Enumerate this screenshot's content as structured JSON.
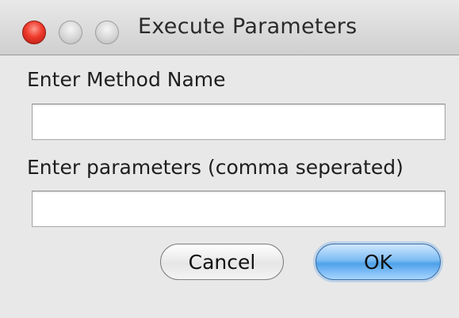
{
  "window": {
    "title": "Execute Parameters"
  },
  "form": {
    "method_label": "Enter Method Name",
    "method_value": "",
    "params_label": "Enter parameters (comma seperated)",
    "params_value": ""
  },
  "buttons": {
    "cancel_label": "Cancel",
    "ok_label": "OK"
  },
  "colors": {
    "close_button": "#ee3a2c",
    "default_button": "#4ea1ea",
    "window_background": "#e8e8e8"
  },
  "icons": {
    "close": "close-icon",
    "minimize": "minimize-icon",
    "zoom": "zoom-icon"
  }
}
